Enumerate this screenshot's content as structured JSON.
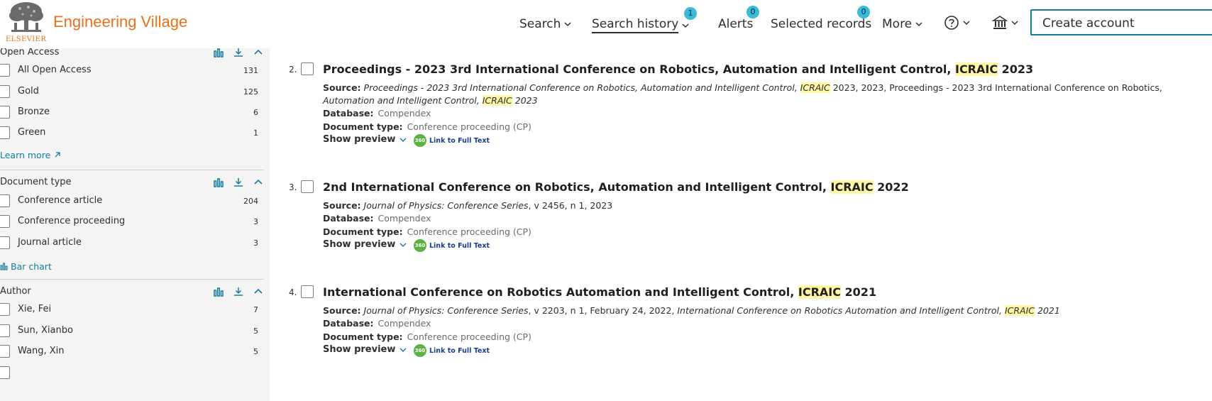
{
  "header": {
    "logo_word": "ELSEVIER",
    "brand": "Engineering Village",
    "nav": {
      "search": "Search",
      "search_history": "Search history",
      "search_history_badge": "1",
      "alerts": "Alerts",
      "alerts_badge": "0",
      "selected_records": "Selected records",
      "selected_records_badge": "0",
      "more": "More"
    },
    "create_account": "Create account"
  },
  "sidebar": {
    "open_access": {
      "title": "Open Access",
      "items": [
        {
          "label": "All Open Access",
          "count": "131"
        },
        {
          "label": "Gold",
          "count": "125"
        },
        {
          "label": "Bronze",
          "count": "6"
        },
        {
          "label": "Green",
          "count": "1"
        }
      ],
      "link": "Learn more"
    },
    "document_type": {
      "title": "Document type",
      "items": [
        {
          "label": "Conference article",
          "count": "204"
        },
        {
          "label": "Conference proceeding",
          "count": "3"
        },
        {
          "label": "Journal article",
          "count": "3"
        }
      ],
      "link": "Bar chart"
    },
    "author": {
      "title": "Author",
      "items": [
        {
          "label": "Xie, Fei",
          "count": "7"
        },
        {
          "label": "Sun, Xianbo",
          "count": "5"
        },
        {
          "label": "Wang, Xin",
          "count": "5"
        }
      ]
    }
  },
  "results": [
    {
      "number": "2.",
      "title_a": "Proceedings - 2023 3rd International Conference on Robotics, Automation and Intelligent Control, ",
      "title_hl": "ICRAIC",
      "title_b": " 2023",
      "source_label": "Source:",
      "source_a": "Proceedings - 2023 3rd International Conference on Robotics, Automation and Intelligent Control, ",
      "source_hl": "ICRAIC",
      "source_b": " 2023, 2023, Proceedings - 2023 3rd International Conference on Robotics,",
      "source2_a": "Automation and Intelligent Control, ",
      "source2_hl": "ICRAIC",
      "source2_b": " 2023",
      "database_label": "Database:",
      "database": "Compendex",
      "doctype_label": "Document type:",
      "doctype": "Conference proceeding (CP)",
      "preview": "Show preview",
      "fulltext": "Link to Full Text"
    },
    {
      "number": "3.",
      "title_a": "2nd International Conference on Robotics, Automation and Intelligent Control, ",
      "title_hl": "ICRAIC",
      "title_b": " 2022",
      "source_label": "Source:",
      "source_italic": "Journal of Physics: Conference Series",
      "source_plain": ", v 2456, n 1, 2023",
      "database_label": "Database:",
      "database": "Compendex",
      "doctype_label": "Document type:",
      "doctype": "Conference proceeding (CP)",
      "preview": "Show preview",
      "fulltext": "Link to Full Text"
    },
    {
      "number": "4.",
      "title_a": "International Conference on Robotics Automation and Intelligent Control, ",
      "title_hl": "ICRAIC",
      "title_b": " 2021",
      "source_label": "Source:",
      "source_italic": "Journal of Physics: Conference Series",
      "source_plain": ", v 2203, n 1, February 24, 2022, ",
      "source_italic2": "International Conference on Robotics Automation and Intelligent Control, ",
      "source_hl": "ICRAIC",
      "source_italic3": " 2021",
      "database_label": "Database:",
      "database": "Compendex",
      "doctype_label": "Document type:",
      "doctype": "Conference proceeding (CP)",
      "preview": "Show preview",
      "fulltext": "Link to Full Text"
    }
  ],
  "icon_360": "360",
  "colors": {
    "brand_orange": "#e9711c",
    "accent_teal": "#147b9c",
    "badge_blue": "#3cbad8",
    "highlight": "#fff6a6",
    "fulltext_green": "#5bb141"
  }
}
